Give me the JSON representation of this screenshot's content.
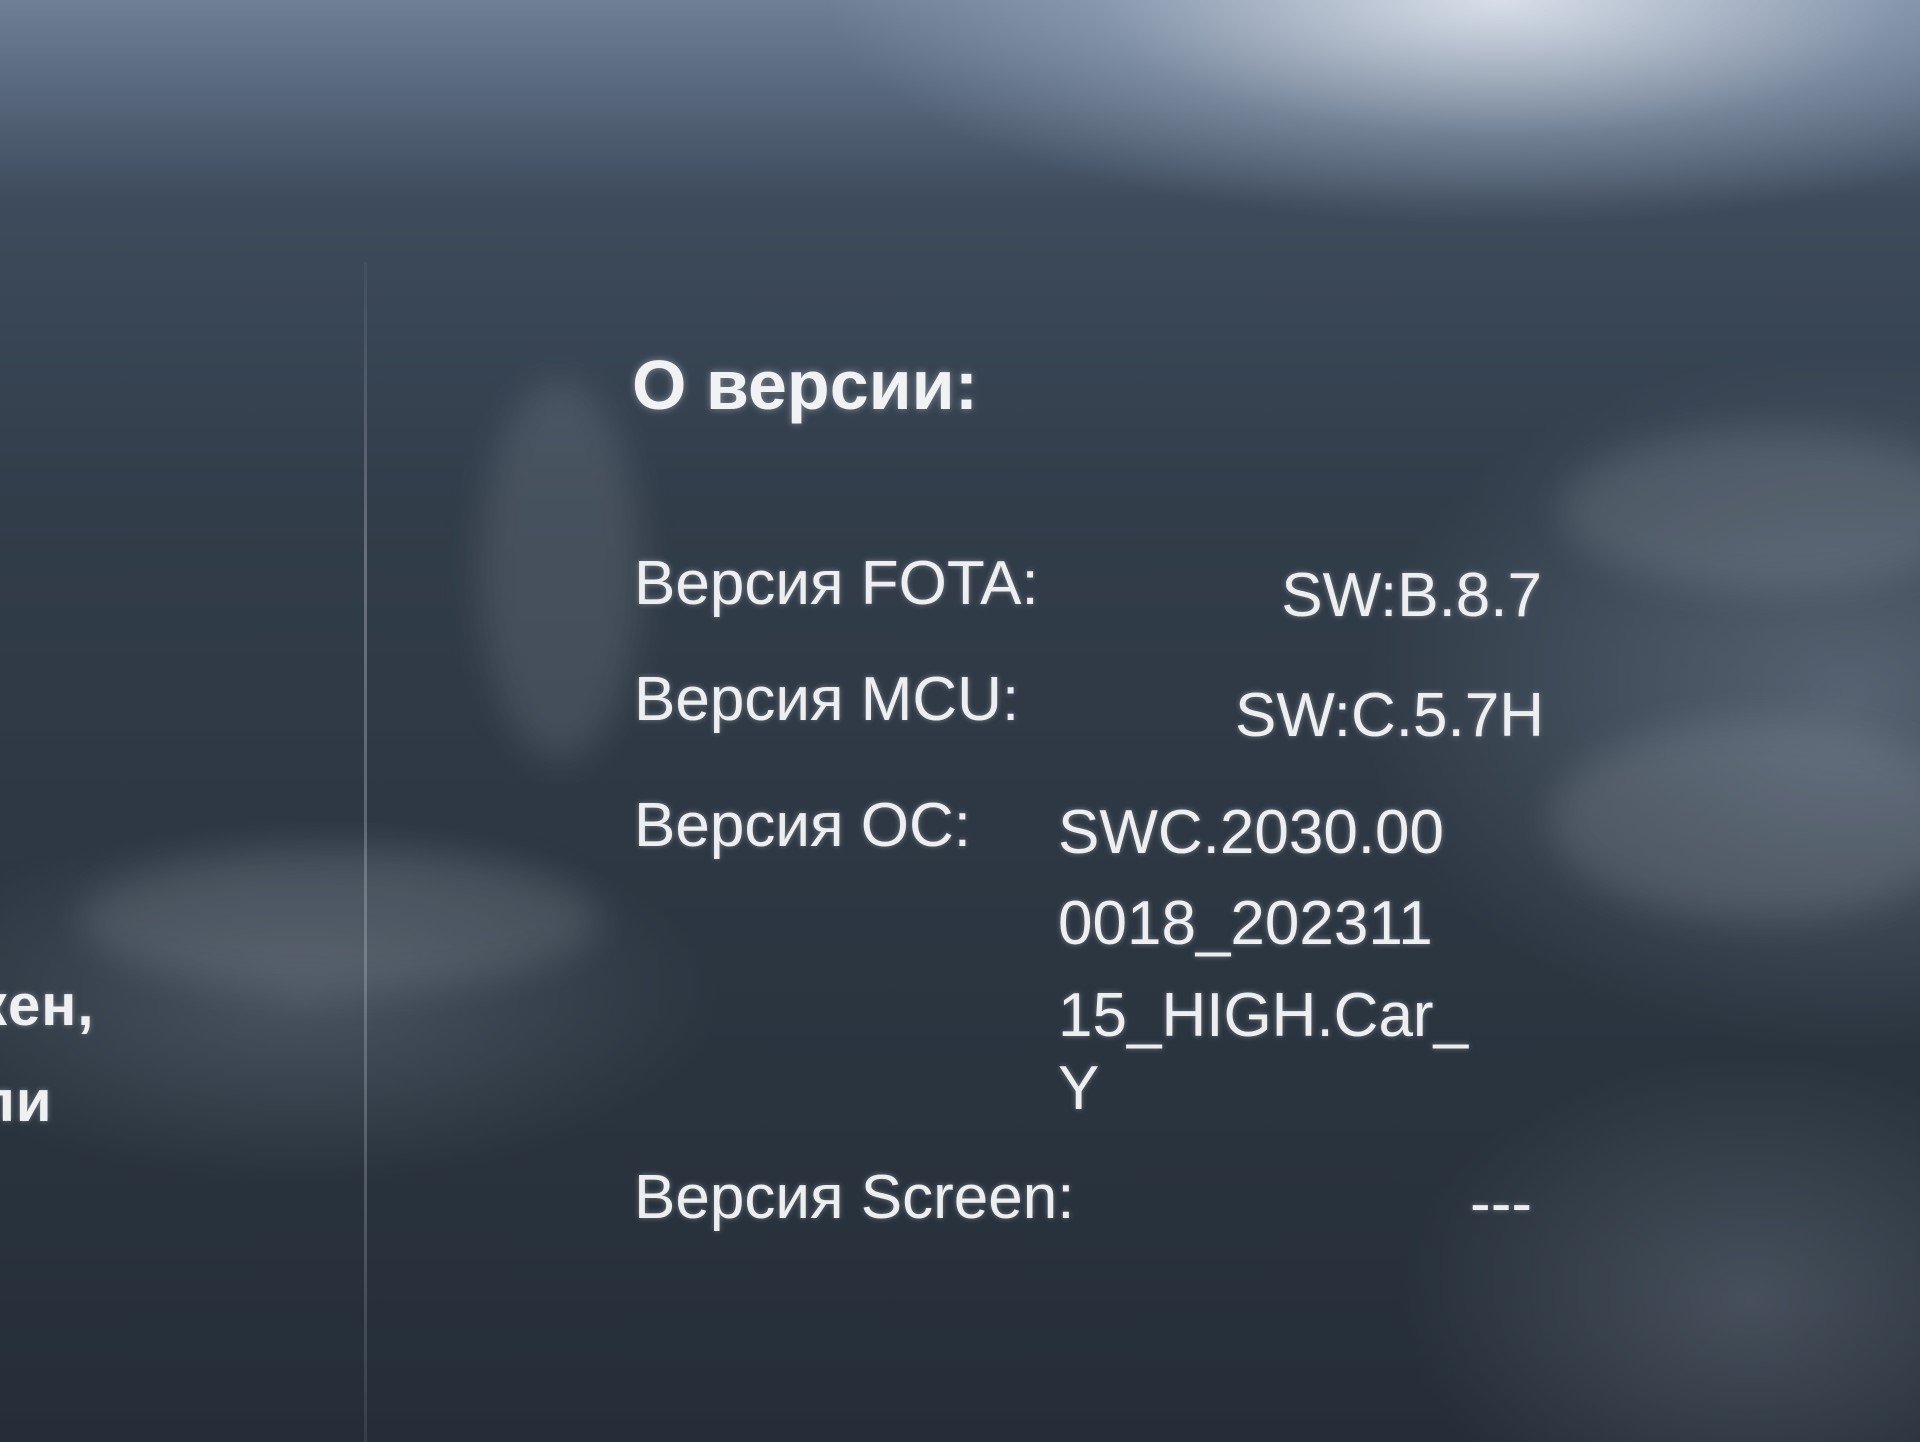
{
  "sidebar": {
    "fragment_line_1": "кен,",
    "fragment_line_2": "ли"
  },
  "about": {
    "title": "О версии:",
    "rows": [
      {
        "label": "Версия FOTA:",
        "value": "SW:B.8.7"
      },
      {
        "label": "Версия MCU:",
        "value": "SW:C.5.7H"
      },
      {
        "label": "Версия ОС:",
        "value_lines": [
          "SWC.2030.00",
          "0018_202311",
          "15_HIGH.Car_",
          "Y"
        ]
      },
      {
        "label": "Версия Screen:",
        "value": "---"
      }
    ]
  }
}
